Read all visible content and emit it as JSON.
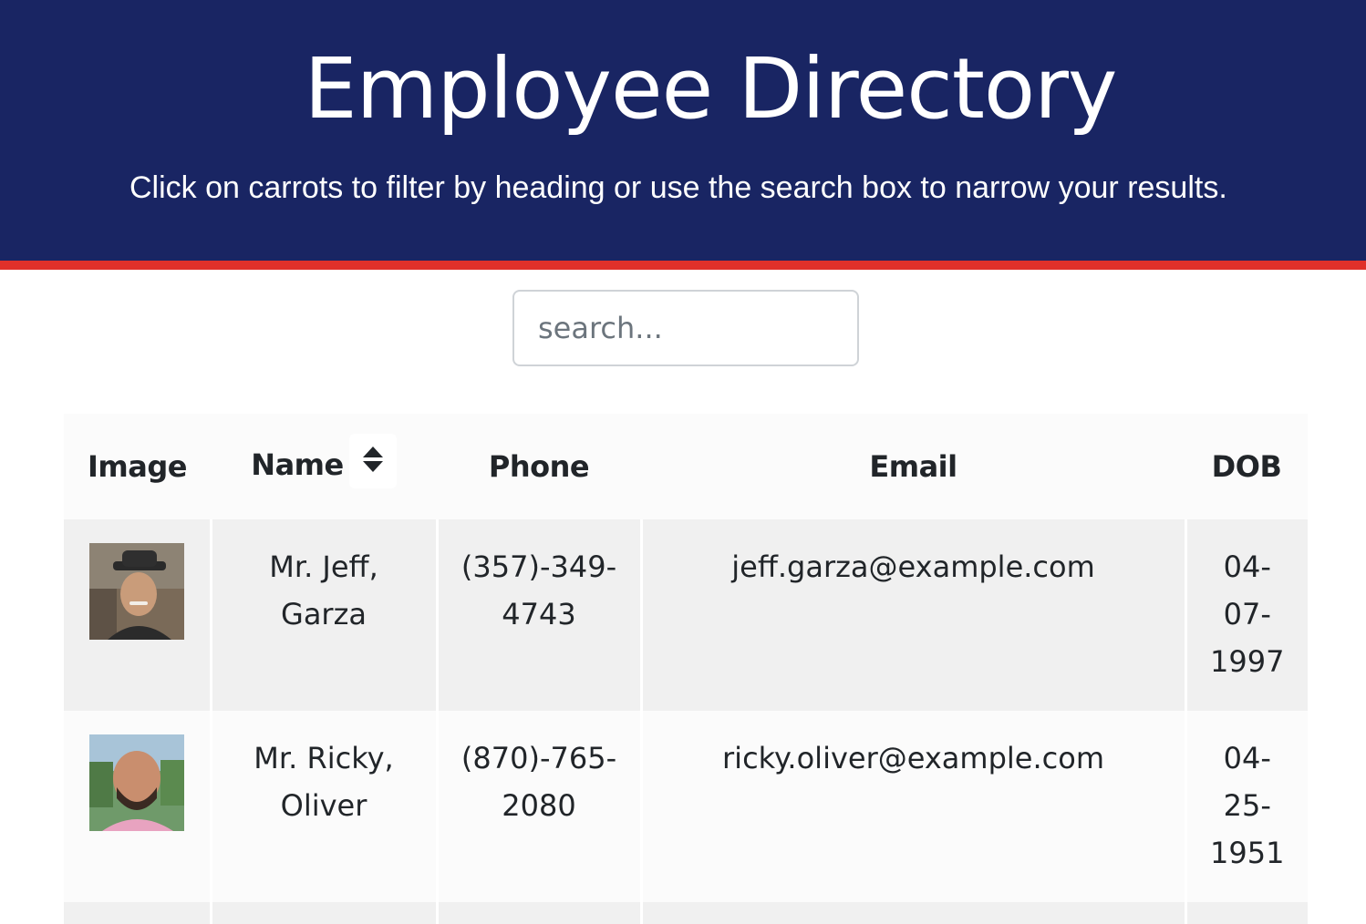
{
  "header": {
    "title": "Employee Directory",
    "subtitle": "Click on carrots to filter by heading or use the search box to narrow your results."
  },
  "search": {
    "placeholder": "search...",
    "value": ""
  },
  "table": {
    "columns": {
      "image": "Image",
      "name": "Name",
      "phone": "Phone",
      "email": "Email",
      "dob": "DOB"
    },
    "sort_icon": "sort-icon",
    "rows": [
      {
        "name_line1": "Mr. Jeff,",
        "name_line2": "Garza",
        "phone_line1": "(357)-349-",
        "phone_line2": "4743",
        "email": "jeff.garza@example.com",
        "dob_line1": "04-",
        "dob_line2": "07-",
        "dob_line3": "1997"
      },
      {
        "name_line1": "Mr. Ricky,",
        "name_line2": "Oliver",
        "phone_line1": "(870)-765-",
        "phone_line2": "2080",
        "email": "ricky.oliver@example.com",
        "dob_line1": "04-",
        "dob_line2": "25-",
        "dob_line3": "1951"
      }
    ]
  },
  "colors": {
    "header_bg": "#192563",
    "header_border": "#e0302a",
    "row_odd": "#f0f0f0",
    "row_even": "#fbfbfb"
  }
}
